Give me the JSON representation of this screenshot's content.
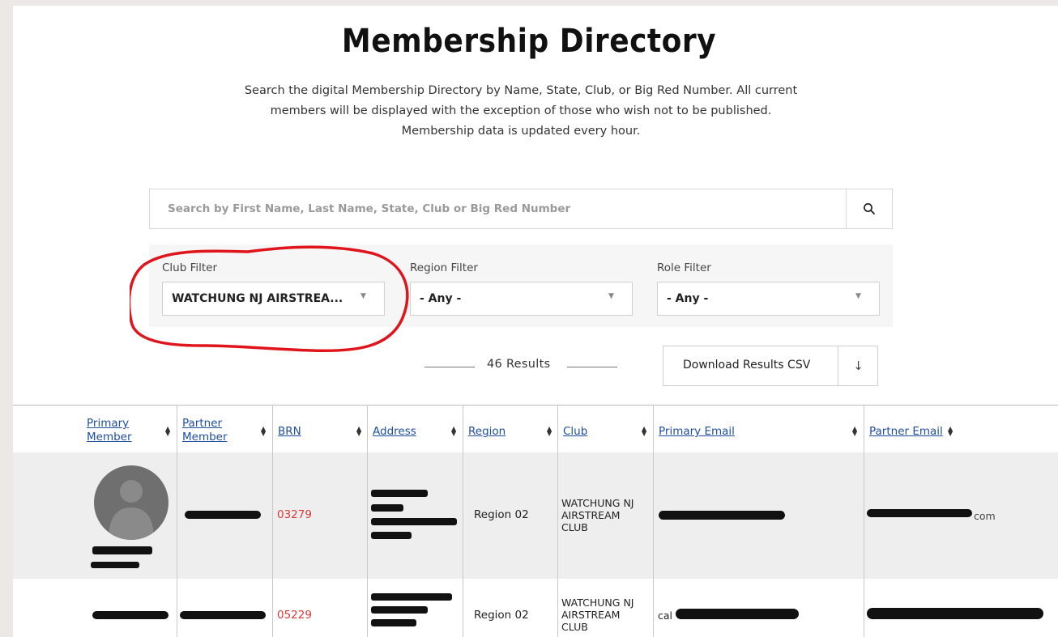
{
  "page": {
    "title": "Membership Directory",
    "description": "Search the digital Membership Directory by Name, State, Club, or Big Red Number. All current members will be displayed with the exception of those who wish not to be published. Membership data is updated every hour."
  },
  "search": {
    "placeholder": "Search by First Name, Last Name, State, Club or Big Red Number",
    "icon": "search-icon"
  },
  "filters": {
    "club": {
      "label": "Club Filter",
      "value": "WATCHUNG NJ AIRSTREA..."
    },
    "region": {
      "label": "Region Filter",
      "value": "- Any -"
    },
    "role": {
      "label": "Role Filter",
      "value": "- Any -"
    }
  },
  "results": {
    "count_text": "46 Results",
    "download_label": "Download Results CSV",
    "download_icon": "↓"
  },
  "table": {
    "columns": [
      {
        "line1": "Primary",
        "line2": "Member"
      },
      {
        "line1": "Partner",
        "line2": "Member"
      },
      {
        "line1": "BRN",
        "line2": ""
      },
      {
        "line1": "Address",
        "line2": ""
      },
      {
        "line1": "Region",
        "line2": ""
      },
      {
        "line1": "Club",
        "line2": ""
      },
      {
        "line1": "Primary Email",
        "line2": ""
      },
      {
        "line1": "Partner Email",
        "line2": ""
      }
    ],
    "rows": [
      {
        "brn": "03279",
        "region": "Region 02",
        "club_line1": "WATCHUNG NJ",
        "club_line2": "AIRSTREAM",
        "club_line3": "CLUB",
        "partner_email_suffix": "com"
      },
      {
        "brn": "05229",
        "region": "Region 02",
        "club_line1": "WATCHUNG NJ",
        "club_line2": "AIRSTREAM",
        "club_line3": "CLUB",
        "primary_email_prefix": "cal"
      }
    ]
  },
  "colors": {
    "link": "#1f4e9e",
    "brn": "#d83a3a",
    "annotation_circle": "#e0141b",
    "row_highlight": "#eeeeee"
  }
}
